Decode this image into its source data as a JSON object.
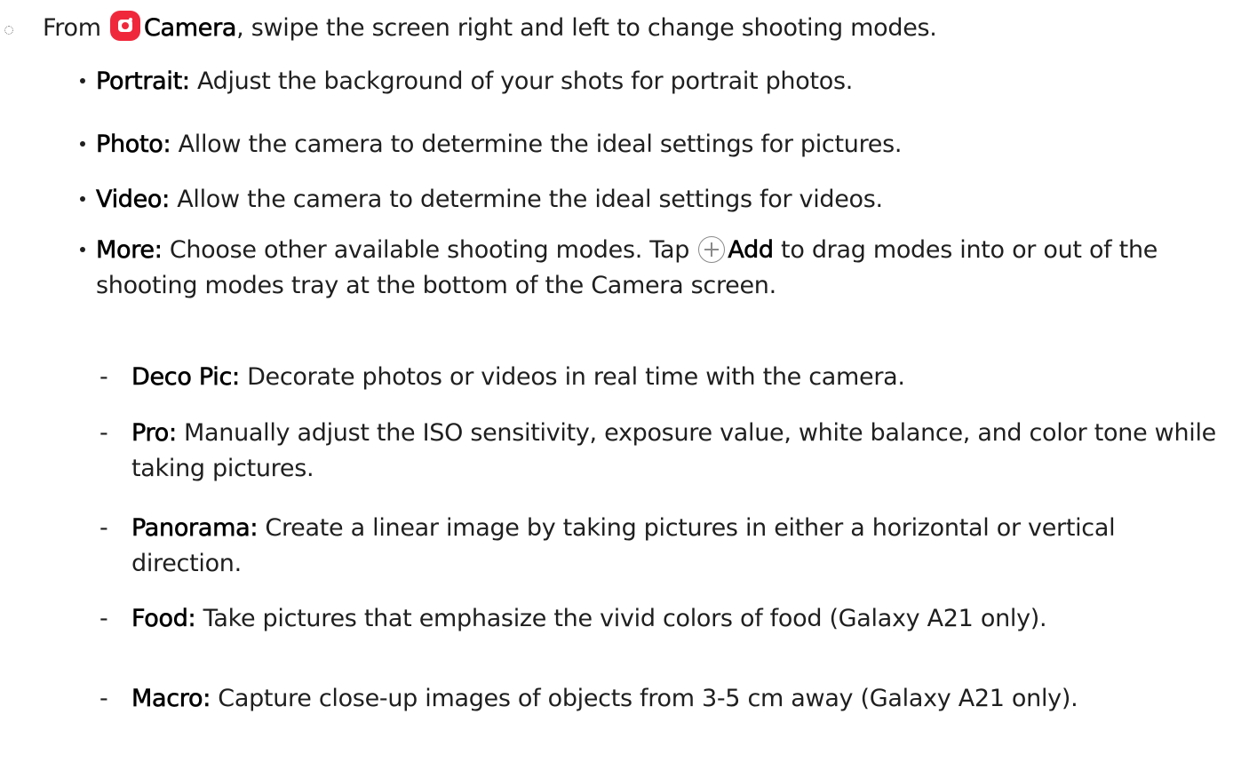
{
  "intro": {
    "prefix": "From",
    "app_name": "Camera",
    "suffix": ", swipe the screen right and left to change shooting modes."
  },
  "modes": [
    {
      "name": "Portrait",
      "separator": ":",
      "desc": " Adjust the background of your shots for portrait photos."
    },
    {
      "name": "Photo",
      "separator": ":",
      "desc": " Allow the camera to determine the ideal settings for pictures."
    },
    {
      "name": "Video",
      "separator": ":",
      "desc": " Allow the camera to determine the ideal settings for videos."
    },
    {
      "name": "More",
      "separator": ":",
      "desc_before": " Choose other available shooting modes. Tap",
      "add_label": "Add",
      "desc_after": " to drag modes into or out of the shooting modes tray at the bottom of the Camera screen."
    }
  ],
  "more_modes": [
    {
      "name": "Deco Pic",
      "separator": ":",
      "desc": " Decorate photos or videos in real time with the camera."
    },
    {
      "name": "Pro",
      "separator": ":",
      "desc": " Manually adjust the ISO sensitivity, exposure value, white balance, and color tone while taking pictures."
    },
    {
      "name": "Panorama",
      "separator": ":",
      "desc": " Create a linear image by taking pictures in either a horizontal or vertical direction."
    },
    {
      "name": "Food",
      "separator": ":",
      "desc": " Take pictures that emphasize the vivid colors of food (Galaxy A21 only)."
    },
    {
      "name": "Macro",
      "separator": ":",
      "desc": " Capture close-up images of objects from 3-5 cm away (Galaxy A21 only)."
    }
  ],
  "dash_glyph": "-",
  "icons": {
    "camera": "camera-app-icon",
    "add": "plus-circle-icon",
    "step": "dotted-circle-icon"
  },
  "colors": {
    "camera_icon": "#f0283c",
    "text": "#1f1f1f"
  }
}
